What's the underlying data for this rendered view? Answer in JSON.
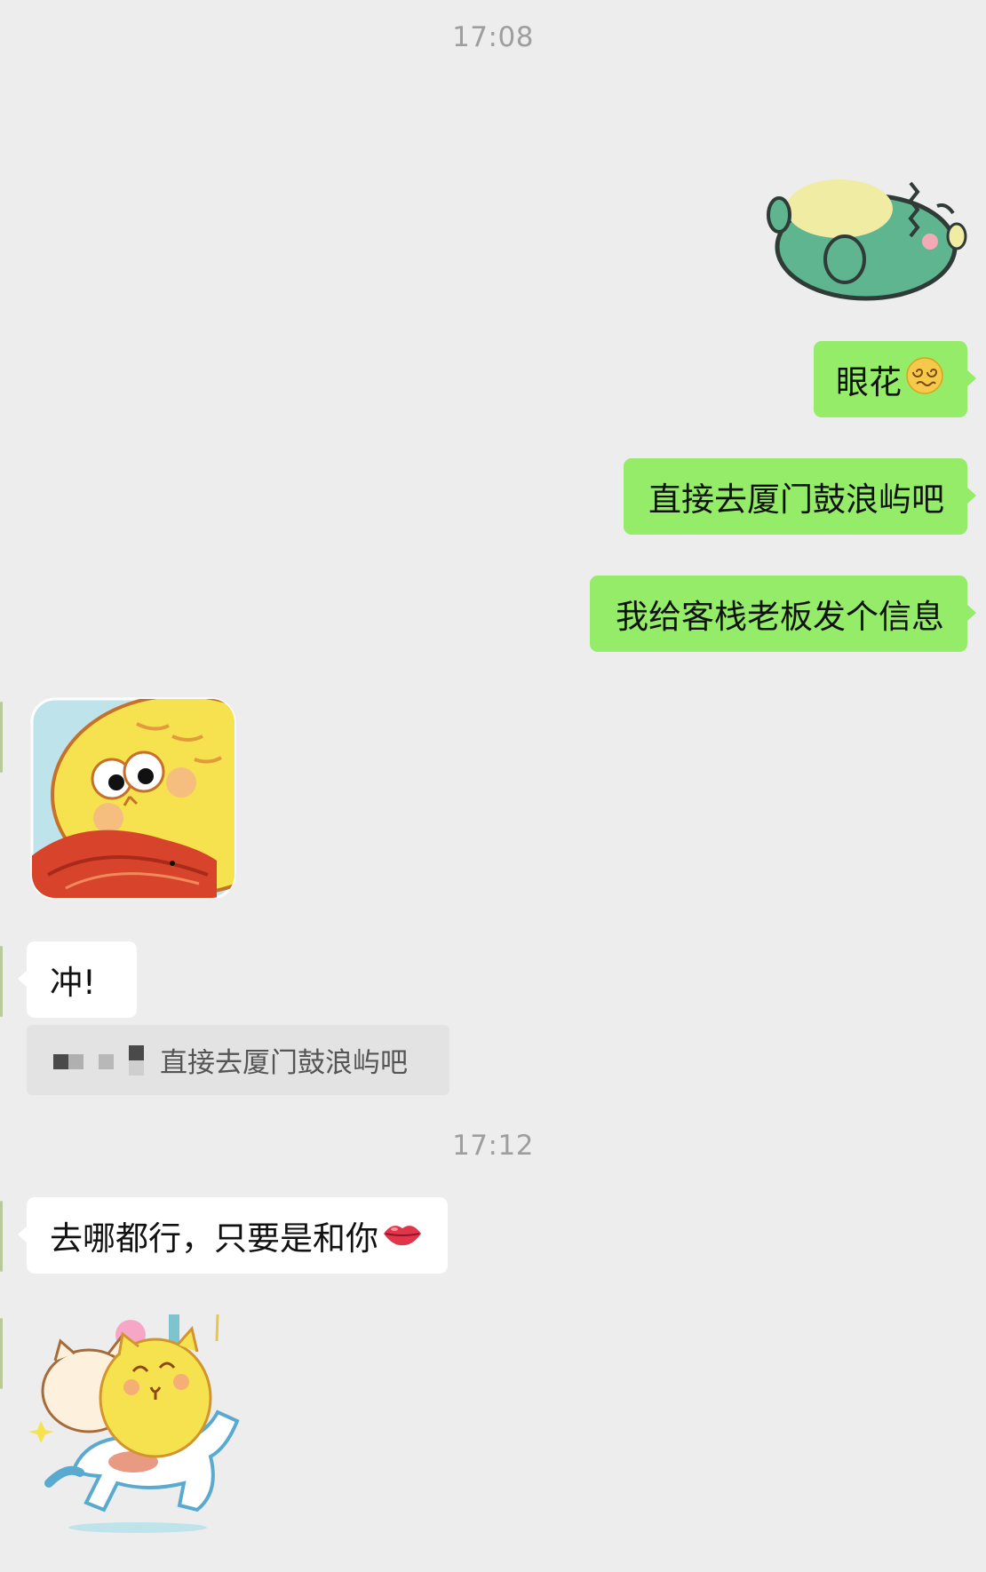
{
  "timestamps": [
    "17:08",
    "17:12"
  ],
  "messages": {
    "m1": {
      "sender": "me",
      "type": "sticker",
      "sticker": "green-dinosaur-sticker"
    },
    "m2": {
      "sender": "me",
      "type": "text",
      "text": "眼花",
      "emoji": "dizzy-face-emoji"
    },
    "m3": {
      "sender": "me",
      "type": "text",
      "text": "直接去厦门鼓浪屿吧"
    },
    "m4": {
      "sender": "me",
      "type": "text",
      "text": "我给客栈老板发个信息"
    },
    "m5": {
      "sender": "other",
      "type": "sticker",
      "sticker": "yellow-cat-with-shrimp-sticker"
    },
    "m6": {
      "sender": "other",
      "type": "text",
      "text": "冲!",
      "quote": {
        "text": "直接去厦门鼓浪屿吧",
        "sender_blurred": true
      }
    },
    "m7": {
      "sender": "other",
      "type": "text",
      "text": "去哪都行，只要是和你",
      "emoji": "kiss-lips-emoji"
    },
    "m8": {
      "sender": "other",
      "type": "sticker",
      "sticker": "cats-on-carousel-sticker"
    }
  },
  "colors": {
    "background": "#ededed",
    "my_bubble": "#95ec69",
    "their_bubble": "#ffffff",
    "timestamp": "#9e9e9e"
  }
}
